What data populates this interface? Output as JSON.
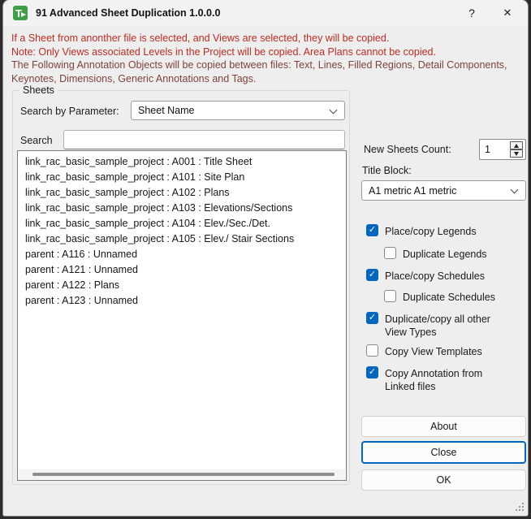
{
  "window": {
    "title": "91 Advanced Sheet Duplication 1.0.0.0",
    "app_icon_letter": "T",
    "help_label": "?",
    "close_label": "✕"
  },
  "warnings": {
    "line1": "If a Sheet from anonther file is selected, and Views are selected, they will be copied.",
    "line2": "Note: Only Views associated Levels in the Project will be copied. Area Plans cannot be copied.",
    "line3": "The Following Annotation Objects will be copied between files: Text, Lines, Filled Regions, Detail Components, Keynotes, Dimensions, Generic Annotations and Tags.",
    "color_primary": "#bb2d23",
    "color_secondary": "#7c423b"
  },
  "sheets_group": {
    "title": "Sheets",
    "search_by_parameter_label": "Search by Parameter:",
    "parameter_value": "Sheet Name",
    "search_label": "Search",
    "search_value": "",
    "items": [
      "link_rac_basic_sample_project : A001 : Title Sheet",
      "link_rac_basic_sample_project : A101 : Site Plan",
      "link_rac_basic_sample_project : A102 : Plans",
      "link_rac_basic_sample_project : A103 : Elevations/Sections",
      "link_rac_basic_sample_project : A104 : Elev./Sec./Det.",
      "link_rac_basic_sample_project : A105 : Elev./ Stair Sections",
      "parent : A116 : Unnamed",
      "parent : A121 : Unnamed",
      "parent : A122 : Plans",
      "parent : A123 : Unnamed"
    ]
  },
  "options": {
    "new_sheets_count_label": "New Sheets Count:",
    "new_sheets_count_value": "1",
    "title_block_label": "Title Block:",
    "title_block_value": "A1 metric A1 metric",
    "checkboxes": [
      {
        "label": "Place/copy Legends",
        "checked": true
      },
      {
        "label": "Duplicate Legends",
        "checked": false
      },
      {
        "label": "Place/copy Schedules",
        "checked": true
      },
      {
        "label": "Duplicate Schedules",
        "checked": false
      },
      {
        "label": "Duplicate/copy all other View Types",
        "checked": true
      },
      {
        "label": "Copy View Templates",
        "checked": false
      },
      {
        "label": "Copy Annotation from Linked files",
        "checked": true
      }
    ]
  },
  "buttons": {
    "about": "About",
    "close": "Close",
    "ok": "OK"
  },
  "colors": {
    "accent": "#0067c0",
    "app_icon_green": "#3d9e47",
    "dialog_bg": "#efeeef"
  }
}
